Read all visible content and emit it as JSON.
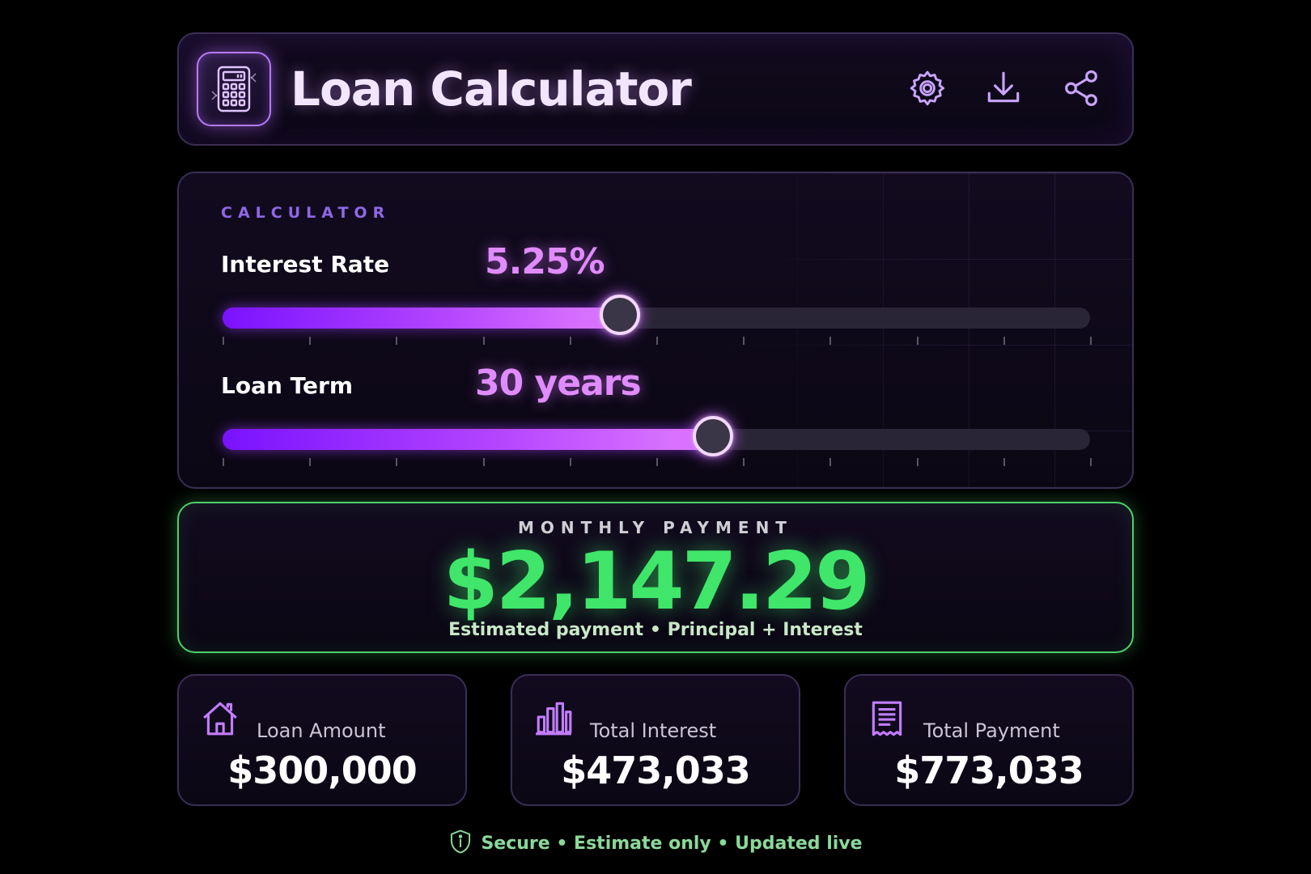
{
  "header": {
    "title": "Loan Calculator",
    "logo_icon": "calculator-icon",
    "actions": [
      {
        "icon": "gear-icon"
      },
      {
        "icon": "download-icon"
      },
      {
        "icon": "share-icon"
      }
    ]
  },
  "calculator": {
    "section_label": "CALCULATOR",
    "interest_rate": {
      "label": "Interest Rate",
      "value": "5.25%",
      "slider_fraction": 0.46
    },
    "loan_term": {
      "label": "Loan Term",
      "value": "30 years",
      "slider_fraction": 0.567
    }
  },
  "payment": {
    "label": "MONTHLY PAYMENT",
    "amount": "$2,147.29",
    "subtitle": "Estimated payment • Principal + Interest"
  },
  "summary": [
    {
      "label": "Loan Amount",
      "value": "$300,000",
      "icon": "house-icon"
    },
    {
      "label": "Total Interest",
      "value": "$473,033",
      "icon": "bar-chart-icon"
    },
    {
      "label": "Total Payment",
      "value": "$773,033",
      "icon": "receipt-icon"
    }
  ],
  "footer": {
    "text": "Secure • Estimate only • Updated live",
    "icon": "shield-icon"
  },
  "colors": {
    "accent_purple": "#b344ff",
    "accent_green": "#3fe66a",
    "background": "#000000"
  }
}
